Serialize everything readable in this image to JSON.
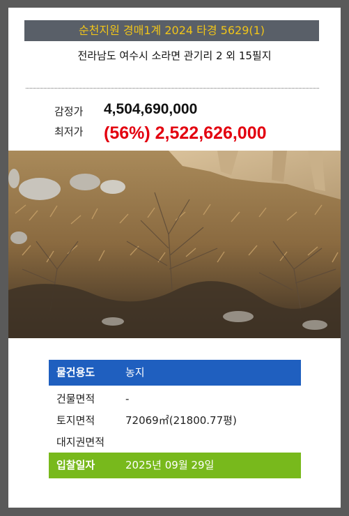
{
  "header": {
    "title": "순천지원 경매1계 2024 타경 5629(1)",
    "address": "전라남도 여수시 소라면 관기리 2 외 15필지"
  },
  "prices": {
    "appraisal_label": "감정가",
    "appraisal_value": "4,504,690,000",
    "minimum_label": "최저가",
    "minimum_value": "(56%) 2,522,626,000"
  },
  "details": {
    "usage_label": "물건용도",
    "usage_value": "농지",
    "building_area_label": "건물면적",
    "building_area_value": "-",
    "land_area_label": "토지면적",
    "land_area_value": "72069㎡(21800.77평)",
    "land_rights_label": "대지권면적",
    "land_rights_value": "",
    "bid_date_label": "입찰일자",
    "bid_date_value": "2025년 09월 29일"
  },
  "colors": {
    "title_bar_bg": "#595f68",
    "title_text": "#f0c419",
    "minimum_price": "#e3000f",
    "usage_row_bg": "#1f5fbf",
    "bid_row_bg": "#78b91c"
  }
}
